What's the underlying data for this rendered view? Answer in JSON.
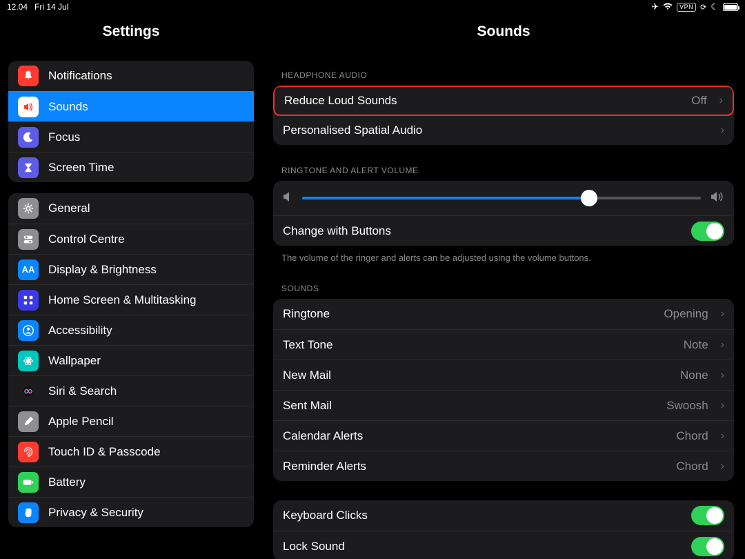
{
  "status": {
    "time": "12.04",
    "date": "Fri 14 Jul",
    "vpn": "VPN"
  },
  "sidebar": {
    "title": "Settings",
    "group1": [
      {
        "label": "Notifications",
        "icon": "bell",
        "color": "#ff3b30"
      },
      {
        "label": "Sounds",
        "icon": "speaker",
        "color": "#ff3b30",
        "selected": true
      },
      {
        "label": "Focus",
        "icon": "moon",
        "color": "#5e5ce6"
      },
      {
        "label": "Screen Time",
        "icon": "hourglass",
        "color": "#5e5ce6"
      }
    ],
    "group2": [
      {
        "label": "General",
        "icon": "gear",
        "color": "#8e8e93"
      },
      {
        "label": "Control Centre",
        "icon": "toggles",
        "color": "#8e8e93"
      },
      {
        "label": "Display & Brightness",
        "icon": "AA",
        "color": "#0a84ff"
      },
      {
        "label": "Home Screen & Multitasking",
        "icon": "grid",
        "color": "#3a3ae6"
      },
      {
        "label": "Accessibility",
        "icon": "person",
        "color": "#0a84ff"
      },
      {
        "label": "Wallpaper",
        "icon": "flower",
        "color": "#00c7be"
      },
      {
        "label": "Siri & Search",
        "icon": "siri",
        "color": "#1c1c1e"
      },
      {
        "label": "Apple Pencil",
        "icon": "pencil",
        "color": "#8e8e93"
      },
      {
        "label": "Touch ID & Passcode",
        "icon": "finger",
        "color": "#ff3b30"
      },
      {
        "label": "Battery",
        "icon": "battery",
        "color": "#30d158"
      },
      {
        "label": "Privacy & Security",
        "icon": "hand",
        "color": "#0a84ff"
      }
    ]
  },
  "main": {
    "title": "Sounds",
    "headphone_header": "HEADPHONE AUDIO",
    "reduce_loud": {
      "label": "Reduce Loud Sounds",
      "value": "Off"
    },
    "spatial": {
      "label": "Personalised Spatial Audio"
    },
    "ringtone_header": "RINGTONE AND ALERT VOLUME",
    "volume_percent": 72,
    "change_buttons": {
      "label": "Change with Buttons",
      "on": true
    },
    "change_note": "The volume of the ringer and alerts can be adjusted using the volume buttons.",
    "sounds_header": "SOUNDS",
    "sounds_rows": [
      {
        "label": "Ringtone",
        "value": "Opening"
      },
      {
        "label": "Text Tone",
        "value": "Note"
      },
      {
        "label": "New Mail",
        "value": "None"
      },
      {
        "label": "Sent Mail",
        "value": "Swoosh"
      },
      {
        "label": "Calendar Alerts",
        "value": "Chord"
      },
      {
        "label": "Reminder Alerts",
        "value": "Chord"
      }
    ],
    "keyboard_clicks": {
      "label": "Keyboard Clicks",
      "on": true
    },
    "lock_sound": {
      "label": "Lock Sound",
      "on": true
    }
  }
}
